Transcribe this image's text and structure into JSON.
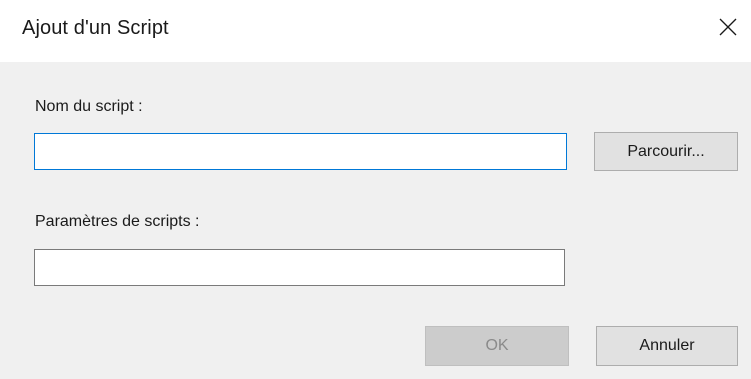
{
  "window": {
    "title": "Ajout d'un Script",
    "close_icon": "close-icon"
  },
  "form": {
    "script_name_label": "Nom du script :",
    "script_name_value": "",
    "script_params_label": "Paramètres de scripts :",
    "script_params_value": ""
  },
  "buttons": {
    "browse_label": "Parcourir...",
    "ok_label": "OK",
    "ok_enabled": false,
    "cancel_label": "Annuler"
  },
  "colors": {
    "focus_border": "#0078d7",
    "dialog_body": "#f0f0f0"
  }
}
